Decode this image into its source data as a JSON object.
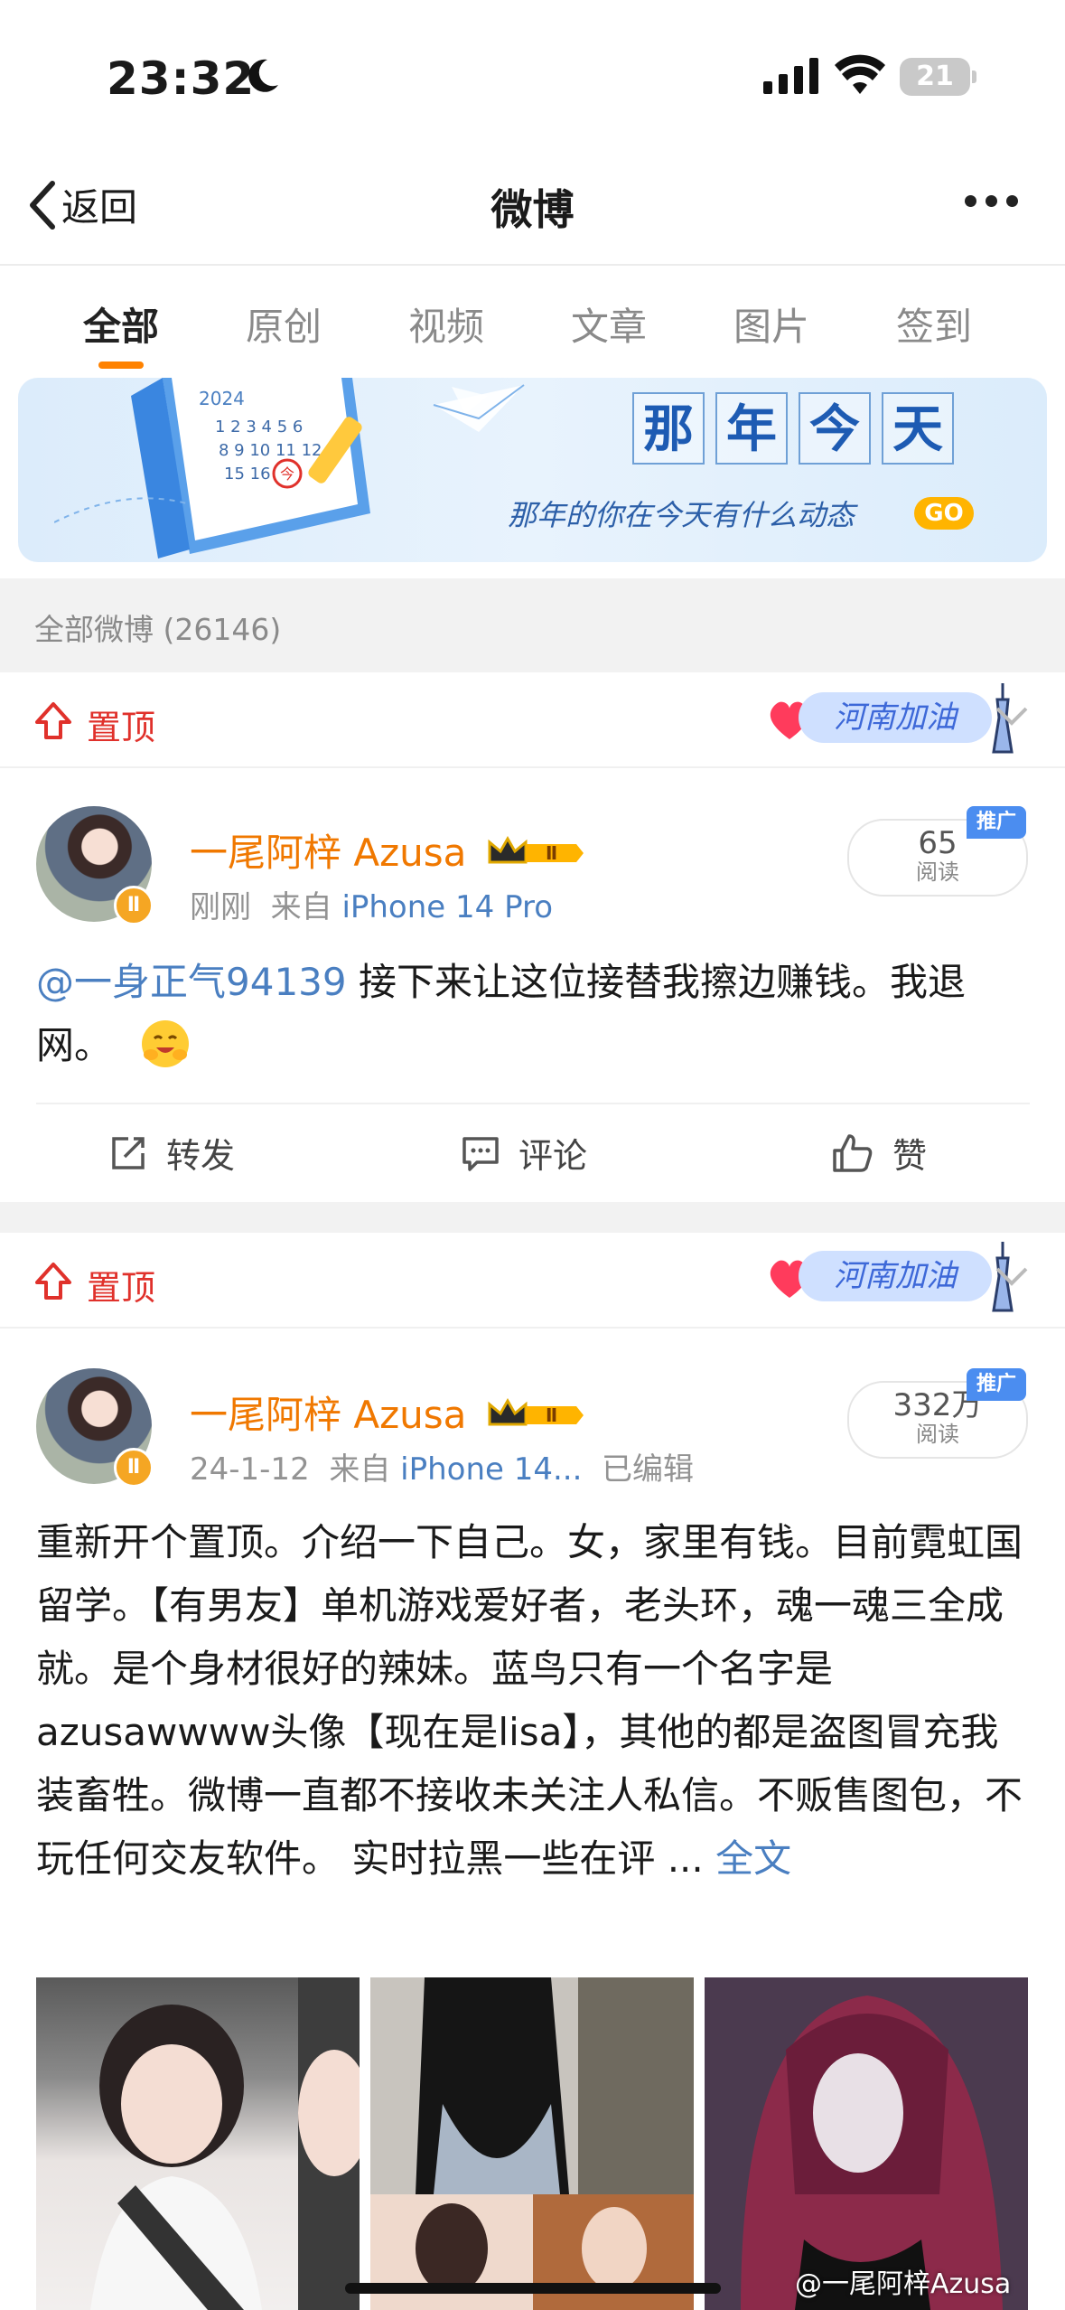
{
  "status_bar": {
    "time": "23:32",
    "battery": "21"
  },
  "nav": {
    "back_label": "返回",
    "title": "微博"
  },
  "tabs": [
    "全部",
    "原创",
    "视频",
    "文章",
    "图片",
    "签到"
  ],
  "banner": {
    "chars": [
      "那",
      "年",
      "今",
      "天"
    ],
    "subtitle": "那年的你在今天有什么动态",
    "go_label": "GO",
    "calendar_year": "2024",
    "calendar_marker": "今"
  },
  "weibo_count": "全部微博 (26146)",
  "pinned_label": "置顶",
  "henan_sticker": "河南加油",
  "posts": [
    {
      "username": "一尾阿梓 Azusa",
      "level": "Ⅱ",
      "time": "刚刚",
      "source_prefix": "来自",
      "source": "iPhone 14 Pro",
      "edited": "",
      "reads": "65",
      "reads_label": "阅读",
      "promo": "推广",
      "mention": "@一身正气94139",
      "text": " 接下来让这位接替我擦边赚钱。我退网。"
    },
    {
      "username": "一尾阿梓 Azusa",
      "level": "Ⅱ",
      "time": "24-1-12",
      "source_prefix": "来自",
      "source": "iPhone 14...",
      "edited": "已编辑",
      "reads": "332万",
      "reads_label": "阅读",
      "promo": "推广",
      "text": "重新开个置顶。介绍一下自己。女，家里有钱。目前霓虹国留学。【有男友】单机游戏爱好者，老头环，魂一魂三全成就。是个身材很好的辣妹。蓝鸟只有一个名字是azusawwww头像【现在是lisa】，其他的都是盗图冒充我装畜牲。微博一直都不接收未关注人私信。不贩售图包，不玩任何交友软件。 实时拉黑一些在评 ...",
      "more_label": "全文"
    }
  ],
  "actions": {
    "repost": "转发",
    "comment": "评论",
    "like": "赞"
  },
  "watermark": "@一尾阿梓Azusa",
  "colors": {
    "accent": "#ff8200",
    "pinned_red": "#e0312b",
    "username_orange": "#f07800",
    "link_blue": "#4a7fc1"
  }
}
